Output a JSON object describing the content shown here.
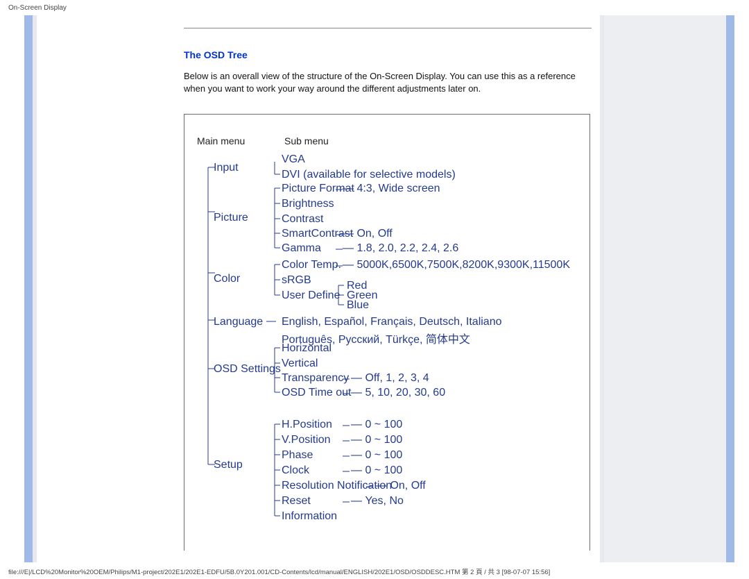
{
  "page_header": "On-Screen Display",
  "section_title": "The OSD Tree",
  "intro": "Below is an overall view of the structure of the On-Screen Display. You can use this as a reference when you want to work your way around the different adjustments later on.",
  "columns": {
    "main": "Main menu",
    "sub": "Sub menu"
  },
  "main_items": {
    "input": "Input",
    "picture": "Picture",
    "color": "Color",
    "language": "Language",
    "osd": "OSD Settings",
    "setup": "Setup"
  },
  "input_sub": {
    "vga": "VGA",
    "dvi": "DVI (available for selective models)"
  },
  "picture_sub": {
    "format": "Picture Format",
    "format_vals": "4:3, Wide screen",
    "brightness": "Brightness",
    "contrast": "Contrast",
    "smart": "SmartContrast",
    "smart_vals": "On, Off",
    "gamma": "Gamma",
    "gamma_vals": "1.8, 2.0, 2.2, 2.4, 2.6"
  },
  "color_sub": {
    "temp": "Color Temp.",
    "temp_vals": "5000K,6500K,7500K,8200K,9300K,11500K",
    "srgb": "sRGB",
    "user": "User Define",
    "user_vals": {
      "r": "Red",
      "g": "Green",
      "b": "Blue"
    }
  },
  "lang_sub": {
    "line1": "English, Español, Français, Deutsch, Italiano",
    "line2": "Português, Русский, Türkçe, 简体中文"
  },
  "osd_sub": {
    "h": "Horizontal",
    "v": "Vertical",
    "tr": "Transparency",
    "tr_vals": "Off, 1, 2, 3, 4",
    "to": "OSD Time out",
    "to_vals": "5, 10, 20, 30, 60"
  },
  "setup_sub": {
    "hp": "H.Position",
    "hp_v": "0 ~ 100",
    "vp": "V.Position",
    "vp_v": "0 ~ 100",
    "ph": "Phase",
    "ph_v": "0 ~ 100",
    "ck": "Clock",
    "ck_v": "0 ~ 100",
    "rn": "Resolution Notification",
    "rn_v": "On, Off",
    "rs": "Reset",
    "rs_v": "Yes, No",
    "in": "Information"
  },
  "footer": "file:///E|/LCD%20Monitor%20OEM/Philips/M1-project/202E1/202E1-EDFU/5B.0Y201.001/CD-Contents/lcd/manual/ENGLISH/202E1/OSD/OSDDESC.HTM 第 2 頁 / 共 3  [98-07-07 15:56]"
}
